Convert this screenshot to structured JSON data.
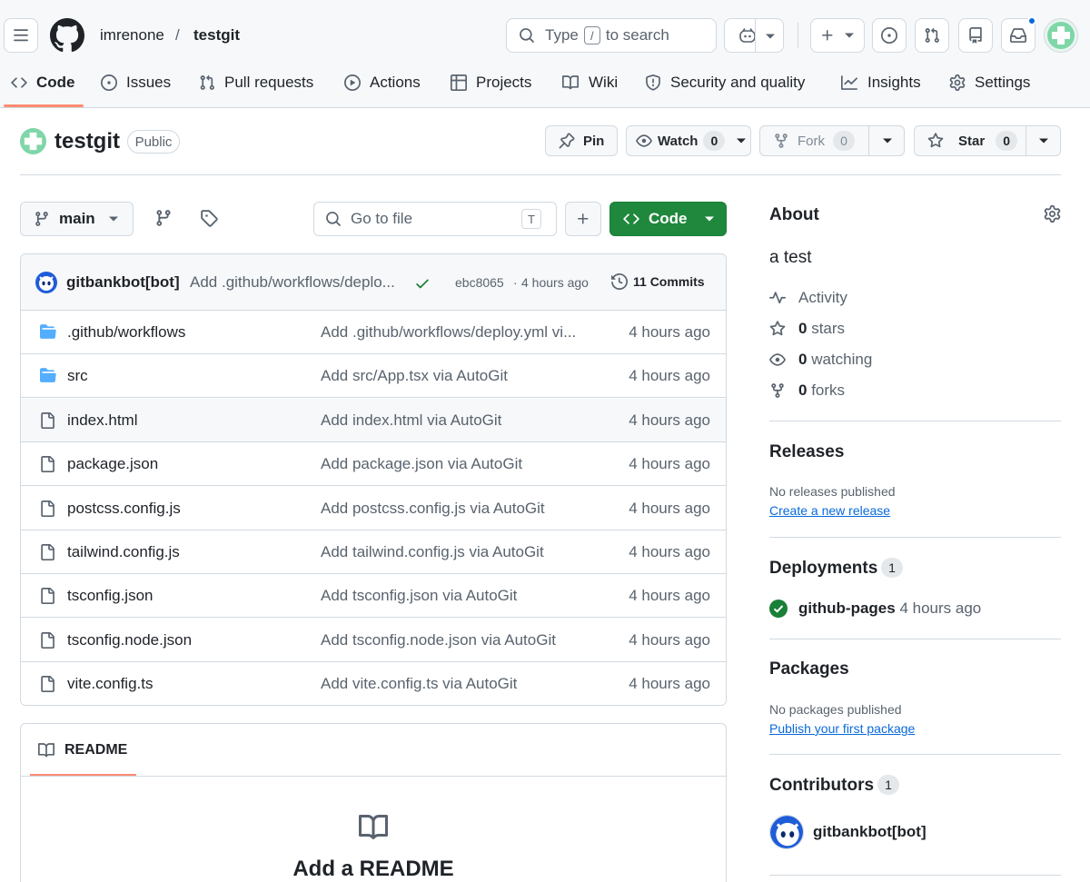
{
  "header": {
    "owner": "imrenone",
    "separator": "/",
    "repo": "testgit",
    "search_pre": "Type",
    "search_key": "/",
    "search_post": "to search"
  },
  "tabs": [
    {
      "label": "Code",
      "icon": "code-icon"
    },
    {
      "label": "Issues",
      "icon": "issue-icon"
    },
    {
      "label": "Pull requests",
      "icon": "pull-request-icon"
    },
    {
      "label": "Actions",
      "icon": "play-icon"
    },
    {
      "label": "Projects",
      "icon": "table-icon"
    },
    {
      "label": "Wiki",
      "icon": "book-icon"
    },
    {
      "label": "Security and quality",
      "icon": "shield-icon"
    },
    {
      "label": "Insights",
      "icon": "graph-icon"
    },
    {
      "label": "Settings",
      "icon": "gear-icon"
    }
  ],
  "repo": {
    "name": "testgit",
    "visibility": "Public",
    "pin_label": "Pin",
    "watch_label": "Watch",
    "watch_count": "0",
    "fork_label": "Fork",
    "fork_count": "0",
    "star_label": "Star",
    "star_count": "0"
  },
  "toolbar": {
    "branch": "main",
    "go_to_file": "Go to file",
    "go_to_file_key": "T",
    "code_label": "Code"
  },
  "latest_commit": {
    "author": "gitbankbot[bot]",
    "message": "Add .github/workflows/deplo...",
    "hash": "ebc8065",
    "time": "4 hours ago",
    "commits_label": "11 Commits"
  },
  "files": [
    {
      "name": ".github/workflows",
      "type": "folder",
      "message": "Add .github/workflows/deploy.yml vi...",
      "date": "4 hours ago"
    },
    {
      "name": "src",
      "type": "folder",
      "message": "Add src/App.tsx via AutoGit",
      "date": "4 hours ago"
    },
    {
      "name": "index.html",
      "type": "file",
      "message": "Add index.html via AutoGit",
      "date": "4 hours ago"
    },
    {
      "name": "package.json",
      "type": "file",
      "message": "Add package.json via AutoGit",
      "date": "4 hours ago"
    },
    {
      "name": "postcss.config.js",
      "type": "file",
      "message": "Add postcss.config.js via AutoGit",
      "date": "4 hours ago"
    },
    {
      "name": "tailwind.config.js",
      "type": "file",
      "message": "Add tailwind.config.js via AutoGit",
      "date": "4 hours ago"
    },
    {
      "name": "tsconfig.json",
      "type": "file",
      "message": "Add tsconfig.json via AutoGit",
      "date": "4 hours ago"
    },
    {
      "name": "tsconfig.node.json",
      "type": "file",
      "message": "Add tsconfig.node.json via AutoGit",
      "date": "4 hours ago"
    },
    {
      "name": "vite.config.ts",
      "type": "file",
      "message": "Add vite.config.ts via AutoGit",
      "date": "4 hours ago"
    }
  ],
  "readme": {
    "tab_label": "README",
    "heading": "Add a README"
  },
  "about": {
    "title": "About",
    "description": "a test",
    "activity": "Activity",
    "stars_count": "0",
    "stars_label": "stars",
    "watching_count": "0",
    "watching_label": "watching",
    "forks_count": "0",
    "forks_label": "forks"
  },
  "releases": {
    "title": "Releases",
    "empty": "No releases published",
    "link": "Create a new release"
  },
  "deployments": {
    "title": "Deployments",
    "count": "1",
    "env": "github-pages",
    "time": "4 hours ago"
  },
  "packages": {
    "title": "Packages",
    "empty": "No packages published",
    "link": "Publish your first package"
  },
  "contributors": {
    "title": "Contributors",
    "count": "1",
    "name": "gitbankbot[bot]"
  },
  "colors": {
    "accent_green": "#1f883d",
    "link_blue": "#0969da",
    "tab_underline": "#fd8c73",
    "folder_blue": "#54aeff"
  }
}
